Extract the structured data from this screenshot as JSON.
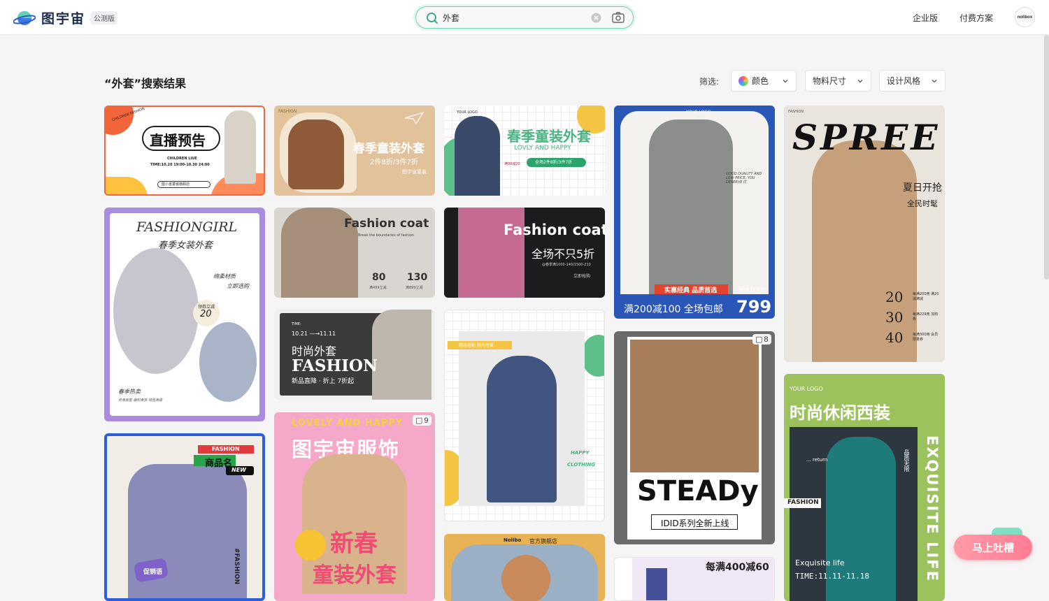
{
  "header": {
    "logo_text": "图宇宙",
    "beta_label": "公测版",
    "search_value": "外套",
    "nav": [
      "企业版",
      "付费方案"
    ],
    "avatar_text": "nolibox"
  },
  "results": {
    "title": "“外套”搜索结果",
    "filter_label": "筛选:",
    "filters": [
      "颜色",
      "物料尺寸",
      "设计风格"
    ]
  },
  "cards": {
    "c1": {
      "title": "直播预告",
      "sub": "CHILDREN LIUE",
      "time": "TIME:10.20 19:00-10.30 24:00",
      "brand": "CHILDREN FASHION",
      "search": "图小宙童装旗舰店"
    },
    "c2": {
      "tag": "FASHION",
      "title": "春季童装外套",
      "sub": "2件8折/3件7折",
      "shop": "图宇宙童装"
    },
    "c3": {
      "logo": "YOUR LOGO",
      "title": "春季童装外套",
      "sub": "LOVLY AND HAPPY",
      "promo": "全场2件8折/3件7折",
      "price": "满99减20",
      "date": "02.02-03.03"
    },
    "c4": {
      "logo": "YOUR LOGO",
      "quality": "GOOD QUALITY AND LOW PRICE, YOU DESERVE IT.",
      "banner": "实惠经典 品质首选",
      "pre": "预估到手价",
      "offer": "满200减100 全场包邮",
      "price": "799"
    },
    "c5": {
      "tag": "FASHION",
      "title": "SPREE",
      "sub": "夏日开抢",
      "sub2": "全民时髦",
      "p1": "20",
      "p1d": "每满200用 满20减满减",
      "p2": "30",
      "p2d": "每满229用 加购券",
      "p3": "40",
      "p3d": "每满300用 会员限量券"
    },
    "c6": {
      "title": "FASHIONGIRL",
      "sub": "春季女装外套",
      "note1": "绵柔材质",
      "note2": "立即选购",
      "coupon": "领券立减",
      "coupon_val": "20",
      "foot": "春季热卖",
      "foot2": "修身版型 面料柔软 纯色高级"
    },
    "c7": {
      "title": "Fashion coat",
      "sub": "Break the boundaries of fashion",
      "v1": "80",
      "v1d": "满499立减",
      "v2": "130",
      "v2d": "满899立减"
    },
    "c8": {
      "title": "Fashion coat",
      "sub": "全场不只5折",
      "note": "@春季满1000-140/1500-210",
      "cta": "立即抢购"
    },
    "c9": {
      "time": "TIME:",
      "dates": "10.21 —→11.11",
      "title": "时尚外套",
      "big": "FASHION",
      "sub": "新品直降 · 折上 7折起"
    },
    "c10": {
      "tag": "精选搭配 阳光可爱",
      "w1": "HAPPY",
      "w2": "CLOTHING"
    },
    "c11": {
      "shop": "Nolibo",
      "sub": "官方旗舰店"
    },
    "c12": {
      "count": "8",
      "title": "STEADy",
      "sub": "IDID系列全新上线"
    },
    "c13": {
      "title": "每满400减60"
    },
    "c14": {
      "tag": "FASHION",
      "name": "商品名",
      "new": "NEW",
      "side": "#FASHION",
      "promo": "促销语"
    },
    "c15": {
      "count": "9",
      "title": "LOVELY AND HAPPY",
      "cn": "图宇宙服饰",
      "big1": "新春",
      "big2": "童装外套"
    },
    "c16": {
      "logo": "YOUR LOGO",
      "title": "时尚休闲西装",
      "ret": "... return",
      "side": "品质无限",
      "tag": "FASHION",
      "life": "Exquisite life",
      "time": "TIME:11.11-11.18",
      "vert": "EXQUISITE LIFE"
    }
  },
  "feedback": {
    "label": "马上吐槽"
  }
}
